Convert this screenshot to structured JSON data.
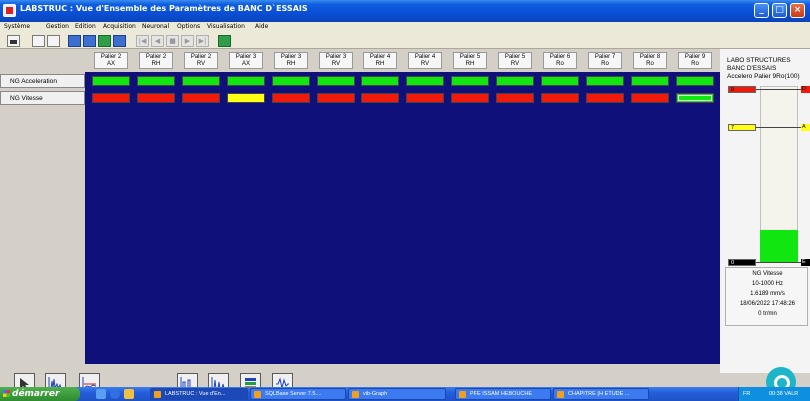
{
  "window": {
    "title": "LABSTRUC : Vue d'Ensemble des Paramètres de BANC D`ESSAIS",
    "controls": [
      "_",
      "□",
      "×"
    ]
  },
  "menu": [
    "Système",
    "Gestion",
    "Edition",
    "Acquisition",
    "Neuronal",
    "Options",
    "Visualisation",
    "Aide"
  ],
  "toolbar": {
    "icons": [
      "print-icon",
      "open-icon",
      "save-icon",
      "config-icon",
      "chart-icon",
      "grid-icon",
      "edit-icon",
      "first-icon",
      "prev-icon",
      "stop-icon",
      "play-icon",
      "last-icon",
      "display-icon"
    ],
    "nav_glyphs": [
      "|◀",
      "◀",
      "■",
      "▶",
      "▶|"
    ]
  },
  "columns": [
    {
      "line1": "Palier 2",
      "line2": "AX"
    },
    {
      "line1": "Palier 2",
      "line2": "RH"
    },
    {
      "line1": "Palier 2",
      "line2": "RV"
    },
    {
      "line1": "Palier 3",
      "line2": "AX"
    },
    {
      "line1": "Palier 3",
      "line2": "RH"
    },
    {
      "line1": "Palier 3",
      "line2": "RV"
    },
    {
      "line1": "Palier 4",
      "line2": "RH"
    },
    {
      "line1": "Palier 4",
      "line2": "RV"
    },
    {
      "line1": "Palier 5",
      "line2": "RH"
    },
    {
      "line1": "Palier 5",
      "line2": "RV"
    },
    {
      "line1": "Palier 6",
      "line2": "Ro"
    },
    {
      "line1": "Palier 7",
      "line2": "Ro"
    },
    {
      "line1": "Palier 8",
      "line2": "Ro"
    },
    {
      "line1": "Palier 9",
      "line2": "Ro"
    }
  ],
  "rows": [
    {
      "label": "NG Acceleration",
      "states": [
        "green",
        "green",
        "green",
        "green",
        "green",
        "green",
        "green",
        "green",
        "green",
        "green",
        "green",
        "green",
        "green",
        "green"
      ]
    },
    {
      "label": "NG Vitesse",
      "states": [
        "red",
        "red",
        "red",
        "yellow",
        "red",
        "red",
        "red",
        "red",
        "red",
        "red",
        "red",
        "red",
        "red",
        "green-selected"
      ]
    }
  ],
  "status_colors": {
    "green": "#11e611",
    "red": "#f01a0a",
    "yellow": "#ffff14",
    "grid_bg": "#10107a"
  },
  "right_panel": {
    "line1": "LABO STRUCTURES",
    "line2": "BANC D'ESSAIS",
    "line3": "Accelero Palier 9Ro(100)",
    "gauge_level": 0.18,
    "markers": [
      {
        "value": "9",
        "color": "#f01a0a",
        "edge": "D"
      },
      {
        "value": "7",
        "color": "#ffff14",
        "edge": "A"
      },
      {
        "value": "0",
        "color": "#000000",
        "edge": "E"
      }
    ],
    "info": [
      "NG Vitesse",
      "10-1000 Hz",
      "1.6189 mm/s",
      "18/06/2022 17:48:26",
      "0 tr/mn"
    ]
  },
  "bottom_buttons": [
    "cursor-icon",
    "spectrum-icon",
    "spectrum-multi-icon",
    "waveform-icon",
    "spectrum-compare-icon",
    "spectrum-stack-icon",
    "signal-icon"
  ],
  "taskbar": {
    "start": "démarrer",
    "tasks": [
      "LABSTRUC : Vue d'En...",
      "SQLBase Server 7.5....",
      "vib-Graph",
      "PFE ISSAM HEBOUCHE",
      "CHAPITRE (H ETUDE ..."
    ],
    "tray_lang": "FR",
    "clock": "00:38 VALR"
  }
}
